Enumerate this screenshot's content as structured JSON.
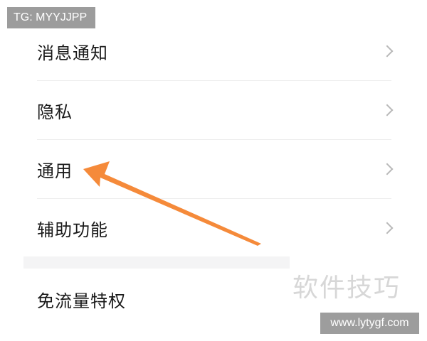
{
  "overlay": {
    "tg_tag": "TG: MYYJJPP",
    "watermark": "软件技巧",
    "site_url": "www.lytygf.com"
  },
  "menu": {
    "items": [
      {
        "label": "消息通知",
        "has_chevron": true
      },
      {
        "label": "隐私",
        "has_chevron": true
      },
      {
        "label": "通用",
        "has_chevron": true,
        "highlighted_by_arrow": true
      },
      {
        "label": "辅助功能",
        "has_chevron": true
      },
      {
        "label": "免流量特权",
        "has_chevron": false
      }
    ]
  },
  "colors": {
    "arrow": "#f58a3a",
    "badge_bg": "#9c9c9c",
    "chevron": "#b8b8b8",
    "label_text": "#1a1a1a"
  }
}
